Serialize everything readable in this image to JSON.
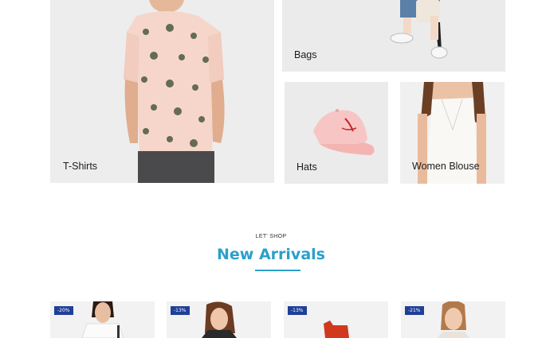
{
  "categories": {
    "tshirts": {
      "label": "T-Shirts"
    },
    "bags": {
      "label": "Bags"
    },
    "hats": {
      "label": "Hats"
    },
    "blouse": {
      "label": "Women Blouse"
    }
  },
  "new_arrivals": {
    "eyebrow": "LET' SHOP",
    "title": "New Arrivals"
  },
  "products": [
    {
      "discount": "-20%"
    },
    {
      "discount": "-13%"
    },
    {
      "discount": "-13%"
    },
    {
      "discount": "-21%"
    }
  ],
  "colors": {
    "accent": "#2aa0c9",
    "badge": "#1f3f98",
    "tile_bg": "#ececec"
  }
}
